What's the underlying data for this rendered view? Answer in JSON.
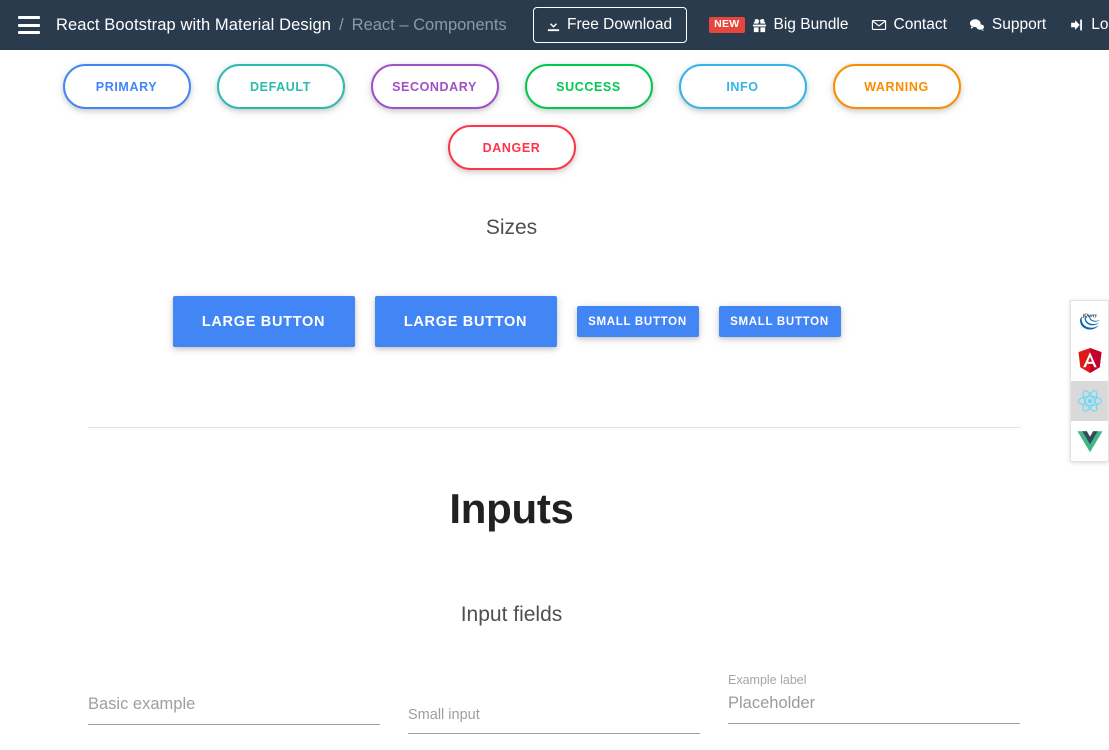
{
  "navbar": {
    "menu_icon": "hamburger-icon",
    "brand": "React Bootstrap with Material Design",
    "separator": "/",
    "breadcrumb": "React – Components",
    "download_button": "Free Download",
    "download_icon": "download-icon",
    "new_badge": "NEW",
    "links": [
      {
        "label": "Big Bundle",
        "icon": "gift-icon"
      },
      {
        "label": "Contact",
        "icon": "envelope-icon"
      },
      {
        "label": "Support",
        "icon": "comments-icon"
      },
      {
        "label": "Log In",
        "icon": "sign-in-icon"
      }
    ],
    "bg_color": "#2a3b4d",
    "badge_color": "#e8453c"
  },
  "outline_buttons": [
    {
      "label": "PRIMARY",
      "color": "#4285f4"
    },
    {
      "label": "DEFAULT",
      "color": "#2bbbad"
    },
    {
      "label": "SECONDARY",
      "color": "#a14fc4"
    },
    {
      "label": "SUCCESS",
      "color": "#00c851"
    },
    {
      "label": "INFO",
      "color": "#33b5e5"
    },
    {
      "label": "WARNING",
      "color": "#fb8c00"
    },
    {
      "label": "DANGER",
      "color": "#ff3547"
    }
  ],
  "sizes": {
    "title": "Sizes",
    "buttons": [
      {
        "label": "LARGE BUTTON",
        "size": "lg"
      },
      {
        "label": "LARGE BUTTON",
        "size": "lg"
      },
      {
        "label": "SMALL BUTTON",
        "size": "sm"
      },
      {
        "label": "SMALL BUTTON",
        "size": "sm"
      }
    ],
    "button_color": "#4285f4"
  },
  "inputs": {
    "title": "Inputs",
    "subtitle": "Input fields",
    "fields": [
      {
        "label": "Basic example",
        "value": "",
        "placeholder": "Basic example"
      },
      {
        "label": "Small input",
        "value": "",
        "placeholder": "Small input"
      },
      {
        "small_label": "Example label",
        "label": "Placeholder",
        "value": "",
        "placeholder": "Placeholder"
      }
    ]
  },
  "framework_sidebar": [
    {
      "name": "jquery",
      "icon": "jquery-icon",
      "active": false
    },
    {
      "name": "angular",
      "icon": "angular-icon",
      "active": false
    },
    {
      "name": "react",
      "icon": "react-icon",
      "active": true
    },
    {
      "name": "vue",
      "icon": "vue-icon",
      "active": false
    }
  ]
}
